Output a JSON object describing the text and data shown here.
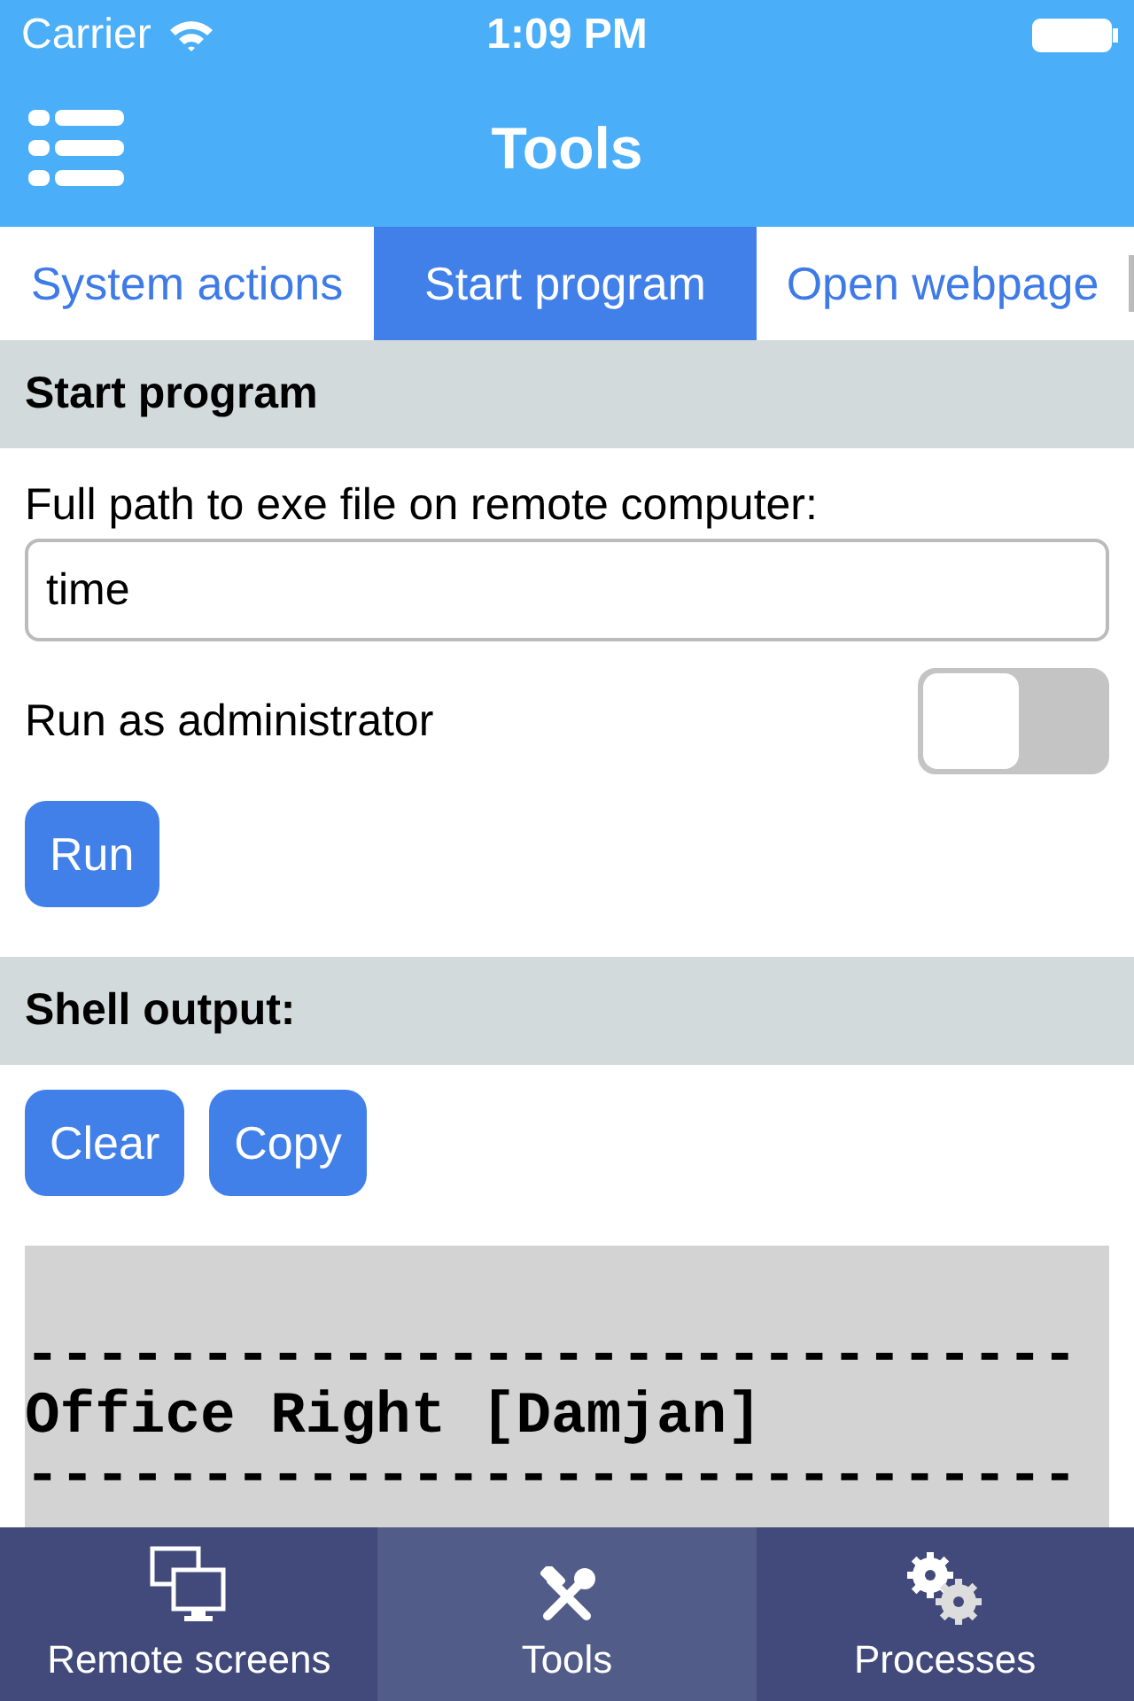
{
  "status_bar": {
    "carrier": "Carrier",
    "time": "1:09 PM"
  },
  "nav_bar": {
    "title": "Tools"
  },
  "tabs": [
    {
      "label": "System actions",
      "selected": false
    },
    {
      "label": "Start program",
      "selected": true
    },
    {
      "label": "Open webpage",
      "selected": false
    }
  ],
  "start_program": {
    "header": "Start program",
    "path_label": "Full path to exe file on remote computer:",
    "path_value": "time",
    "admin_label": "Run as administrator",
    "admin_on": false,
    "run_button": "Run"
  },
  "shell_output": {
    "header": "Shell output:",
    "buttons": [
      "Clear",
      "Copy"
    ],
    "lines": [
      "------------------------------",
      "Office Right [Damjan]",
      "------------------------------"
    ]
  },
  "tab_bar": [
    {
      "label": "Remote screens",
      "selected": false
    },
    {
      "label": "Tools",
      "selected": true
    },
    {
      "label": "Processes",
      "selected": false
    }
  ]
}
